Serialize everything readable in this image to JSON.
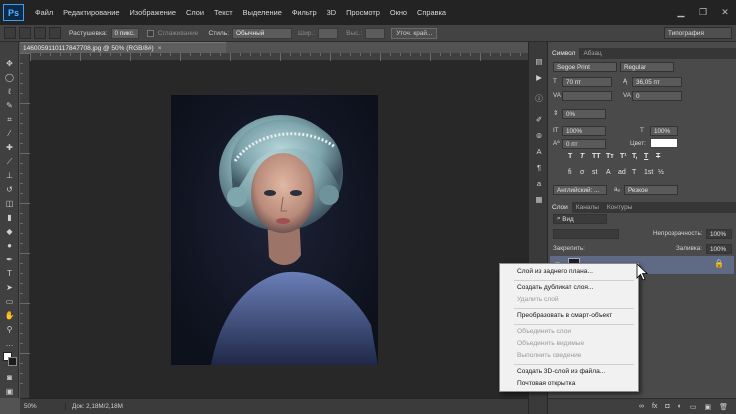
{
  "app": {
    "logo": "Ps",
    "accent": "#31a8ff"
  },
  "menubar": {
    "items": [
      "Файл",
      "Редактирование",
      "Изображение",
      "Слои",
      "Текст",
      "Выделение",
      "Фильтр",
      "3D",
      "Просмотр",
      "Окно",
      "Справка"
    ],
    "window_controls": [
      "minimize-icon",
      "restore-icon",
      "close-icon"
    ]
  },
  "options_bar": {
    "feather_label": "Растушевка:",
    "feather_value": "0 пикс.",
    "antialias_label": "Сглаживание",
    "style_label": "Стиль:",
    "style_value": "Обычный",
    "width_label": "Шир.:",
    "height_label": "Выс.:",
    "refine_edge": "Уточ. край...",
    "workspace": "Типография"
  },
  "document": {
    "tab_title": "1460059110117847708.jpg @ 50% (RGB/8#)",
    "zoom": "50%",
    "doc_info": "Док: 2,18M/2,18M"
  },
  "character_panel": {
    "tabs": [
      "Символ",
      "Абзац"
    ],
    "font_family": "Segoe Print",
    "font_style": "Regular",
    "font_size": "70 пт",
    "leading": "36,05 пт",
    "kerning": "",
    "tracking": "0",
    "vertical_scale_or_pct": "0%",
    "scale_h": "100%",
    "scale_v": "100%",
    "baseline": "0 пт",
    "color_label": "Цвет:",
    "language": "Английский: ...",
    "antialias": "Резкое",
    "color_value": "#ffffff",
    "style_glyphs": [
      "T",
      "T",
      "TT",
      "Tт",
      "T¹",
      "T,",
      "T",
      "T"
    ],
    "style_glyphs2": [
      "fi",
      "σ",
      "st",
      "A",
      "ad",
      "T",
      "1st",
      "½"
    ]
  },
  "layers_panel": {
    "tabs": [
      "Слои",
      "Каналы",
      "Контуры"
    ],
    "filter_label": "Вид",
    "opacity_label": "Непрозрачность:",
    "opacity_value": "100%",
    "lock_label": "Закрепить:",
    "fill_label": "Заливка:",
    "fill_value": "100%"
  },
  "context_menu": {
    "items": [
      {
        "label": "Слой из заднего плана...",
        "disabled": false
      },
      {
        "label": "Создать дубликат слоя...",
        "disabled": false
      },
      {
        "label": "Удалить слой",
        "disabled": true
      },
      {
        "label": "Преобразовать в смарт-объект",
        "disabled": false
      },
      {
        "label": "Объединить слои",
        "disabled": true
      },
      {
        "label": "Объединить видимые",
        "disabled": true
      },
      {
        "label": "Выполнить сведение",
        "disabled": true
      },
      {
        "label": "Создать 3D-слой из файла...",
        "disabled": false
      },
      {
        "label": "Почтовая открытка",
        "disabled": false
      }
    ]
  }
}
